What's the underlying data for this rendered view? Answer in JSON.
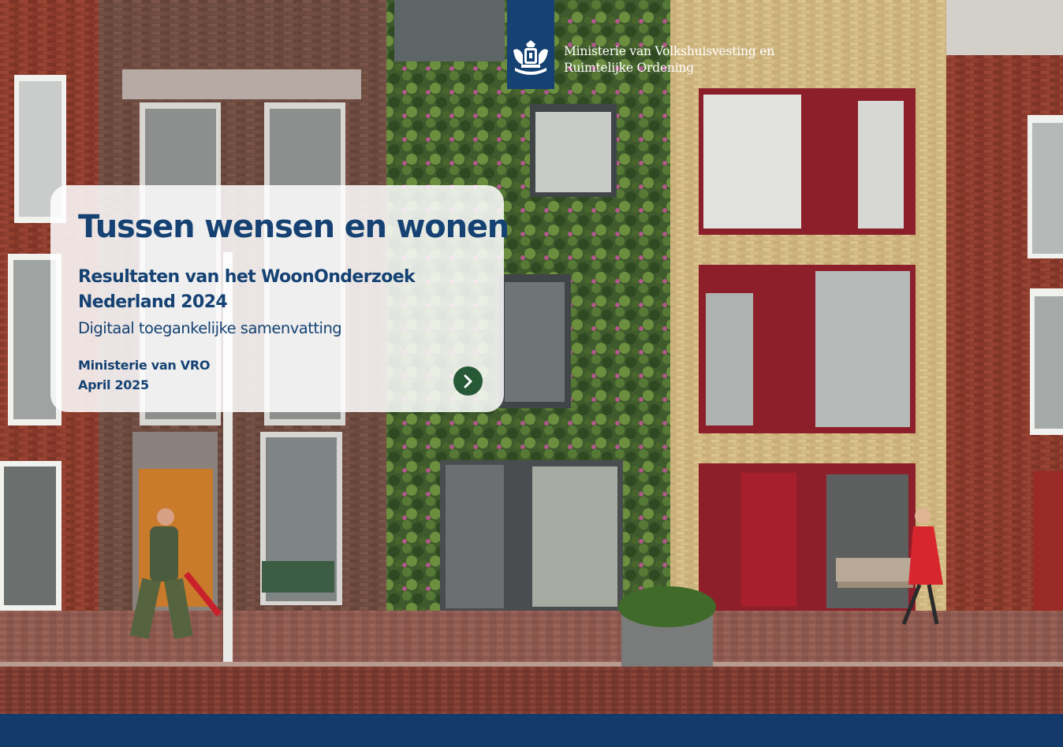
{
  "colors": {
    "brand_blue": "#154273",
    "footer_blue": "#14396b",
    "button_green": "#275937"
  },
  "header": {
    "ministry_line1": "Ministerie van Volkshuisvesting en",
    "ministry_line2": "Ruimtelijke Ordening",
    "logo_icon": "rijksoverheid-emblem-icon"
  },
  "card": {
    "title": "Tussen wensen en wonen",
    "subtitle_line1": "Resultaten van het WoonOnderzoek",
    "subtitle_line2": "Nederland 2024",
    "tagline": "Digitaal toegankelijke samenvatting",
    "publisher": "Ministerie van VRO",
    "date": "April 2025",
    "next_icon": "chevron-right-icon"
  }
}
